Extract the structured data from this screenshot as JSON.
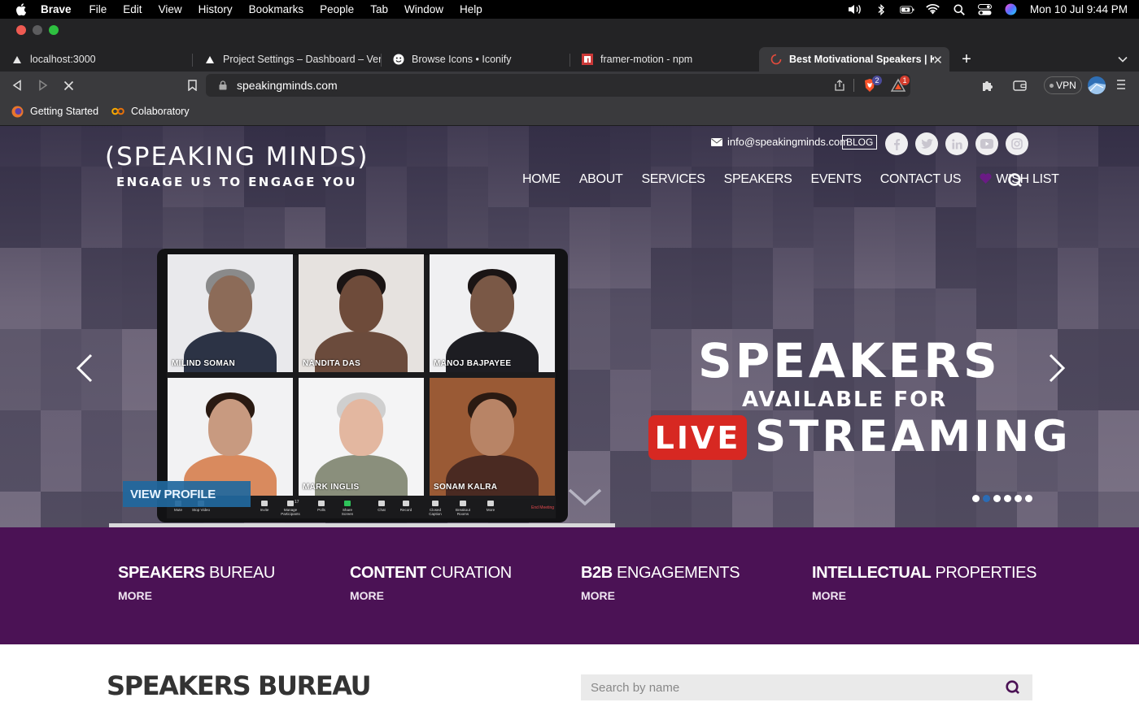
{
  "menubar": {
    "app": "Brave",
    "items": [
      "File",
      "Edit",
      "View",
      "History",
      "Bookmarks",
      "People",
      "Tab",
      "Window",
      "Help"
    ],
    "clock": "Mon 10 Jul  9:44 PM"
  },
  "tabs": [
    {
      "title": "localhost:3000"
    },
    {
      "title": "Project Settings – Dashboard – Vercel"
    },
    {
      "title": "Browse Icons • Iconify"
    },
    {
      "title": "framer-motion - npm"
    },
    {
      "title": "Best Motivational Speakers | Keynote"
    }
  ],
  "toolbar": {
    "url": "speakingminds.com",
    "shield_count": "2",
    "rewards_count": "1",
    "vpn_label": "VPN"
  },
  "bookmarks": [
    {
      "label": "Getting Started"
    },
    {
      "label": "Colaboratory"
    }
  ],
  "site": {
    "logo": "(SPEAKING MINDS)",
    "tagline": "ENGAGE US TO ENGAGE YOU",
    "email": "info@speakingminds.com",
    "blog": "BLOG",
    "nav": [
      "HOME",
      "ABOUT",
      "SERVICES",
      "SPEAKERS",
      "EVENTS",
      "CONTACT US"
    ],
    "wishlist": "WISH LIST",
    "hero": {
      "line1": "SPEAKERS",
      "line2": "AVAILABLE FOR",
      "live": "LIVE",
      "line3": "STREAMING",
      "view_profile": "VIEW PROFILE",
      "speakers": [
        "MILIND SOMAN",
        "NANDITA DAS",
        "MANOJ BAJPAYEE",
        "",
        "MARK INGLIS",
        "SONAM KALRA"
      ],
      "end_meeting": "End Meeting",
      "zoom_controls": [
        "Mute",
        "Stop Video",
        "Invite",
        "Manage Participants",
        "Polls",
        "Share Screen",
        "Chat",
        "Record",
        "Closed Caption",
        "Breakout Rooms",
        "More"
      ],
      "participants_count": "17",
      "slide_count": 6,
      "active_slide": 2
    },
    "services": [
      {
        "bold": "SPEAKERS",
        "rest": " BUREAU",
        "more": "MORE"
      },
      {
        "bold": "CONTENT",
        "rest": " CURATION",
        "more": "MORE"
      },
      {
        "bold": "B2B",
        "rest": " ENGAGEMENTS",
        "more": "MORE"
      },
      {
        "bold": "INTELLECTUAL",
        "rest": " PROPERTIES",
        "more": "MORE"
      }
    ],
    "bureau_title": "SPEAKERS BUREAU",
    "search_placeholder": "Search by name"
  },
  "colors": {
    "services_bg": "#4b1255",
    "live_red": "#d72822",
    "view_profile_blue": "#21689e",
    "active_dot": "#2b6cb5"
  }
}
